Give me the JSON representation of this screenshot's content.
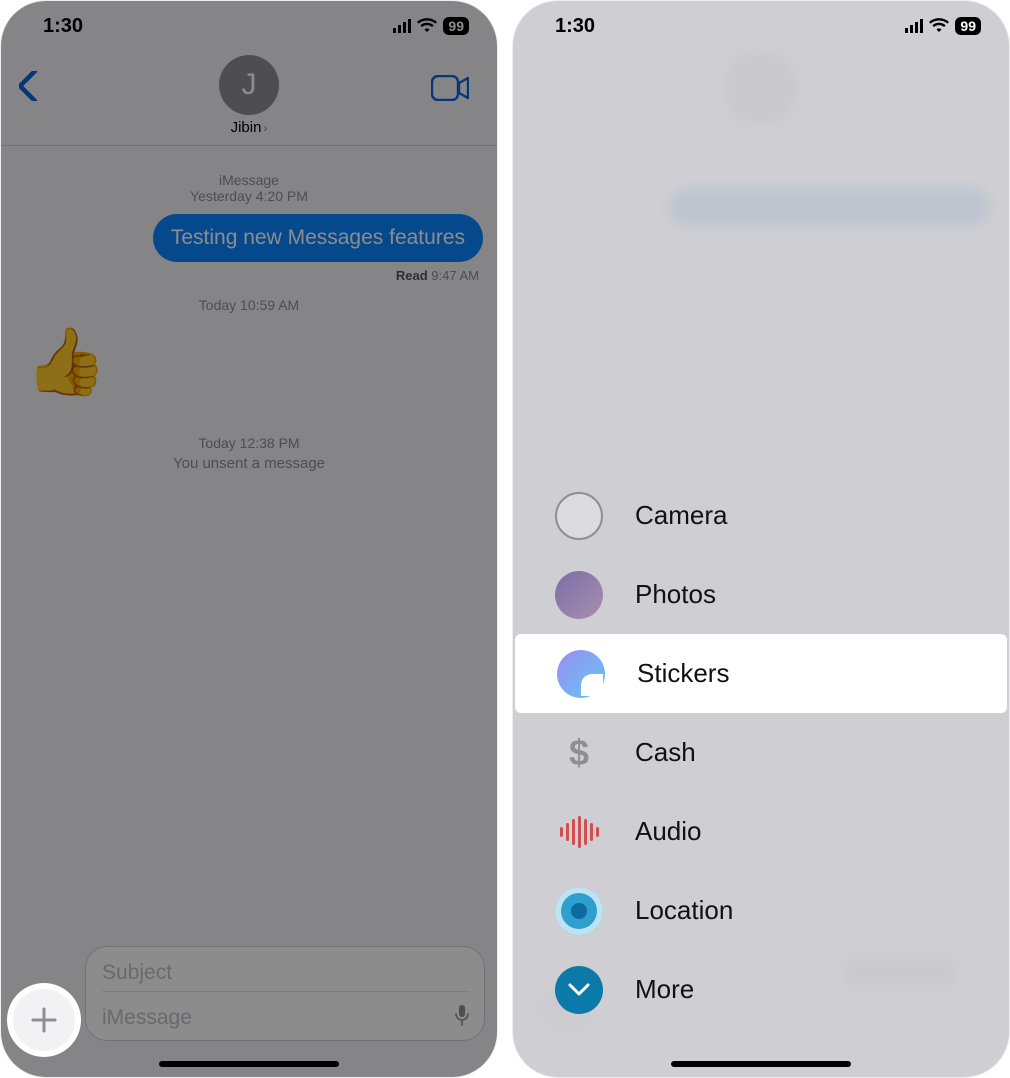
{
  "status": {
    "time": "1:30",
    "battery": "99"
  },
  "conversation": {
    "contact_initial": "J",
    "contact_name": "Jibin",
    "service_label": "iMessage",
    "ts1": "Yesterday 4:20 PM",
    "sent_bubble": "Testing new Messages features",
    "read_prefix": "Read",
    "read_time": "9:47 AM",
    "ts2": "Today 10:59 AM",
    "sticker": "👍",
    "ts3": "Today 12:38 PM",
    "unsent_text": "You unsent a message"
  },
  "compose": {
    "subject_placeholder": "Subject",
    "message_placeholder": "iMessage"
  },
  "plus_menu": {
    "items": [
      {
        "key": "camera",
        "label": "Camera"
      },
      {
        "key": "photos",
        "label": "Photos"
      },
      {
        "key": "stickers",
        "label": "Stickers"
      },
      {
        "key": "cash",
        "label": "Cash"
      },
      {
        "key": "audio",
        "label": "Audio"
      },
      {
        "key": "location",
        "label": "Location"
      },
      {
        "key": "more",
        "label": "More"
      }
    ],
    "highlighted_index": 2
  }
}
